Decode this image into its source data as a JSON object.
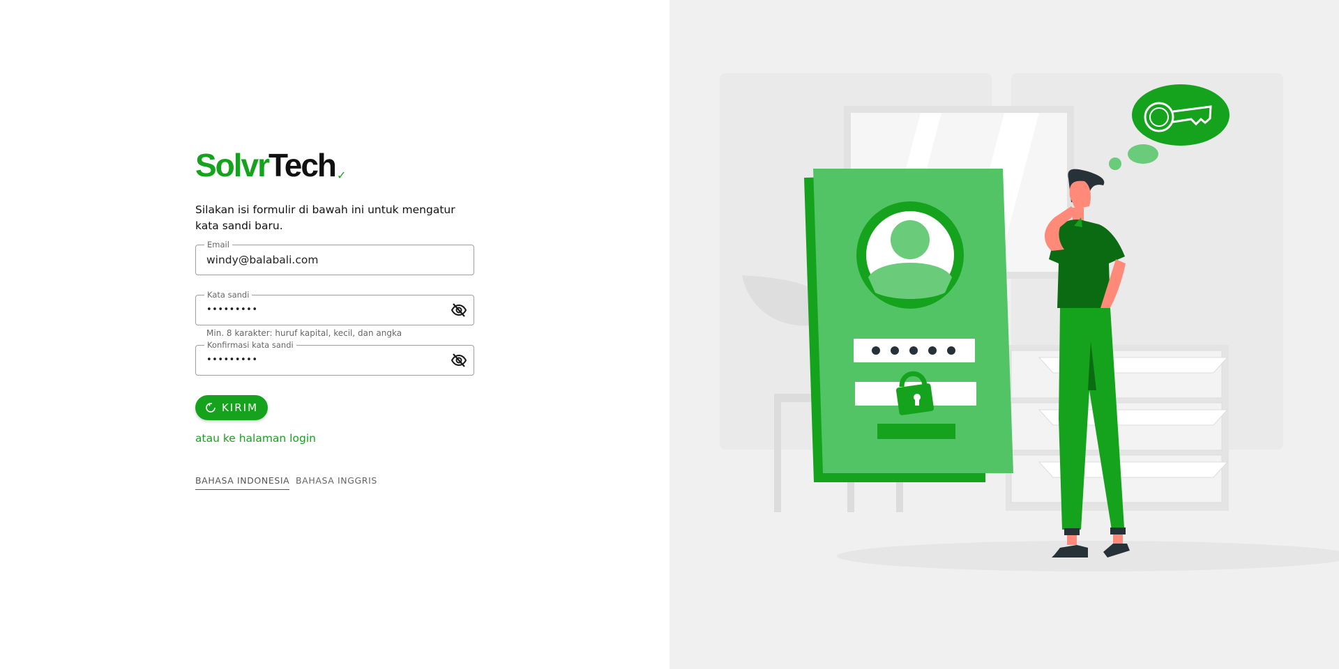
{
  "brand": {
    "part1": "Solvr",
    "part2": "Tech",
    "check": "✓"
  },
  "form": {
    "instructions": "Silakan isi formulir di bawah ini untuk mengatur kata sandi baru.",
    "email": {
      "label": "Email",
      "value": "windy@balabali.com"
    },
    "password": {
      "label": "Kata sandi",
      "value": "•••••••••",
      "helper": "Min. 8 karakter: huruf kapital, kecil, dan angka"
    },
    "confirm": {
      "label": "Konfirmasi kata sandi",
      "value": "•••••••••"
    },
    "submit_label": "KIRIM",
    "login_link": "atau ke halaman login"
  },
  "languages": [
    {
      "label": "BAHASA INDONESIA",
      "active": true
    },
    {
      "label": "BAHASA INGGRIS",
      "active": false
    }
  ],
  "colors": {
    "brand_green": "#15a31e",
    "panel_bg": "#f0f0f0"
  },
  "icons": {
    "password_toggle": "eye-off-icon",
    "submit": "refresh-icon",
    "illustration": "key-thought-bubble"
  }
}
